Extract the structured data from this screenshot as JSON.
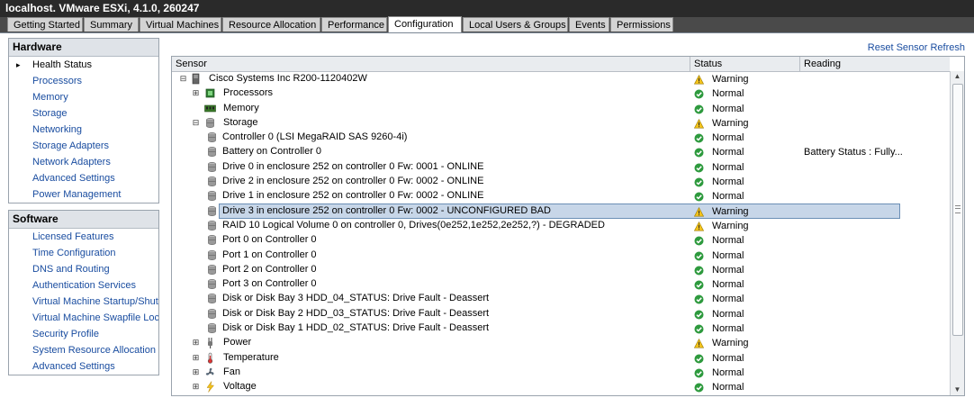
{
  "window": {
    "title": "localhost. VMware ESXi, 4.1.0, 260247"
  },
  "tabs": [
    {
      "label": "Getting Started",
      "active": false
    },
    {
      "label": "Summary",
      "active": false
    },
    {
      "label": "Virtual Machines",
      "active": false
    },
    {
      "label": "Resource Allocation",
      "active": false
    },
    {
      "label": "Performance",
      "active": false
    },
    {
      "label": "Configuration",
      "active": true
    },
    {
      "label": "Local Users & Groups",
      "active": false
    },
    {
      "label": "Events",
      "active": false
    },
    {
      "label": "Permissions",
      "active": false
    }
  ],
  "hardware": {
    "header": "Hardware",
    "items": [
      "Health Status",
      "Processors",
      "Memory",
      "Storage",
      "Networking",
      "Storage Adapters",
      "Network Adapters",
      "Advanced Settings",
      "Power Management"
    ]
  },
  "software": {
    "header": "Software",
    "items": [
      "Licensed Features",
      "Time Configuration",
      "DNS and Routing",
      "Authentication Services",
      "Virtual Machine Startup/Shutdown",
      "Virtual Machine Swapfile Location",
      "Security Profile",
      "System Resource Allocation",
      "Advanced Settings"
    ]
  },
  "reset_link": "Reset Sensor Refresh",
  "grid": {
    "columns": [
      "Sensor",
      "Status",
      "Reading"
    ],
    "rows": [
      {
        "name": "Cisco Systems Inc R200-1120402W",
        "level": 0,
        "expander": "minus",
        "icon": "server-icon",
        "status": "Warning",
        "reading": ""
      },
      {
        "name": "Processors",
        "level": 1,
        "expander": "plus",
        "icon": "processor-icon",
        "status": "Normal",
        "reading": ""
      },
      {
        "name": "Memory",
        "level": 1,
        "expander": "none",
        "icon": "memory-icon",
        "status": "Normal",
        "reading": ""
      },
      {
        "name": "Storage",
        "level": 1,
        "expander": "minus",
        "icon": "disk-icon",
        "status": "Warning",
        "reading": ""
      },
      {
        "name": "Controller 0 (LSI MegaRAID SAS 9260-4i)",
        "level": 2,
        "expander": "none",
        "icon": "disk-icon",
        "status": "Normal",
        "reading": ""
      },
      {
        "name": "Battery on Controller 0",
        "level": 2,
        "expander": "none",
        "icon": "disk-icon",
        "status": "Normal",
        "reading": "Battery Status : Fully..."
      },
      {
        "name": "Drive 0 in enclosure 252 on controller 0 Fw: 0001 - ONLINE",
        "level": 2,
        "expander": "none",
        "icon": "disk-icon",
        "status": "Normal",
        "reading": ""
      },
      {
        "name": "Drive 2 in enclosure 252 on controller 0 Fw: 0002 - ONLINE",
        "level": 2,
        "expander": "none",
        "icon": "disk-icon",
        "status": "Normal",
        "reading": ""
      },
      {
        "name": "Drive 1 in enclosure 252 on controller 0 Fw: 0002 - ONLINE",
        "level": 2,
        "expander": "none",
        "icon": "disk-icon",
        "status": "Normal",
        "reading": ""
      },
      {
        "name": "Drive 3 in enclosure 252 on controller 0 Fw: 0002 - UNCONFIGURED BAD",
        "level": 2,
        "expander": "none",
        "icon": "disk-icon",
        "status": "Warning",
        "reading": "",
        "selected": true
      },
      {
        "name": "RAID 10 Logical Volume 0 on controller 0, Drives(0e252,1e252,2e252,?)  - DEGRADED",
        "level": 2,
        "expander": "none",
        "icon": "disk-icon",
        "status": "Warning",
        "reading": ""
      },
      {
        "name": "Port 0 on Controller 0",
        "level": 2,
        "expander": "none",
        "icon": "disk-icon",
        "status": "Normal",
        "reading": ""
      },
      {
        "name": "Port 1 on Controller 0",
        "level": 2,
        "expander": "none",
        "icon": "disk-icon",
        "status": "Normal",
        "reading": ""
      },
      {
        "name": "Port 2 on Controller 0",
        "level": 2,
        "expander": "none",
        "icon": "disk-icon",
        "status": "Normal",
        "reading": ""
      },
      {
        "name": "Port 3 on Controller 0",
        "level": 2,
        "expander": "none",
        "icon": "disk-icon",
        "status": "Normal",
        "reading": ""
      },
      {
        "name": "Disk or Disk Bay 3 HDD_04_STATUS: Drive Fault - Deassert",
        "level": 2,
        "expander": "none",
        "icon": "disk-icon",
        "status": "Normal",
        "reading": ""
      },
      {
        "name": "Disk or Disk Bay 2 HDD_03_STATUS: Drive Fault - Deassert",
        "level": 2,
        "expander": "none",
        "icon": "disk-icon",
        "status": "Normal",
        "reading": ""
      },
      {
        "name": "Disk or Disk Bay 1 HDD_02_STATUS: Drive Fault - Deassert",
        "level": 2,
        "expander": "none",
        "icon": "disk-icon",
        "status": "Normal",
        "reading": ""
      },
      {
        "name": "Power",
        "level": 1,
        "expander": "plus",
        "icon": "power-icon",
        "status": "Warning",
        "reading": ""
      },
      {
        "name": "Temperature",
        "level": 1,
        "expander": "plus",
        "icon": "thermometer-icon",
        "status": "Normal",
        "reading": ""
      },
      {
        "name": "Fan",
        "level": 1,
        "expander": "plus",
        "icon": "fan-icon",
        "status": "Normal",
        "reading": ""
      },
      {
        "name": "Voltage",
        "level": 1,
        "expander": "plus",
        "icon": "voltage-icon",
        "status": "Normal",
        "reading": ""
      }
    ]
  },
  "colors": {
    "link": "#1a4da0",
    "normal": "#2e9a3e",
    "warning": "#f2c21b",
    "selection": "#c7d6e8"
  }
}
